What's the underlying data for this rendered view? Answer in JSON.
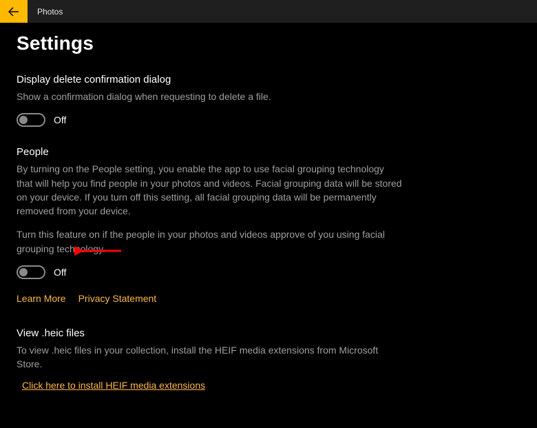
{
  "app_title": "Photos",
  "page_title": "Settings",
  "sections": {
    "delete_confirm": {
      "title": "Display delete confirmation dialog",
      "desc": "Show a confirmation dialog when requesting to delete a file.",
      "toggle_state": "Off"
    },
    "people": {
      "title": "People",
      "desc1": "By turning on the People setting, you enable the app to use facial grouping technology that will help you find people in your photos and videos. Facial grouping data will be stored on your device. If you turn off this setting, all facial grouping data will be permanently removed from your device.",
      "desc2": "Turn this feature on if the people in your photos and videos approve of you using facial grouping technology.",
      "toggle_state": "Off",
      "learn_more": "Learn More",
      "privacy": "Privacy Statement"
    },
    "heic": {
      "title": "View .heic files",
      "desc": "To view .heic files in your collection, install the HEIF media extensions from Microsoft Store.",
      "install_link": "Click here to install HEIF media extensions"
    }
  }
}
